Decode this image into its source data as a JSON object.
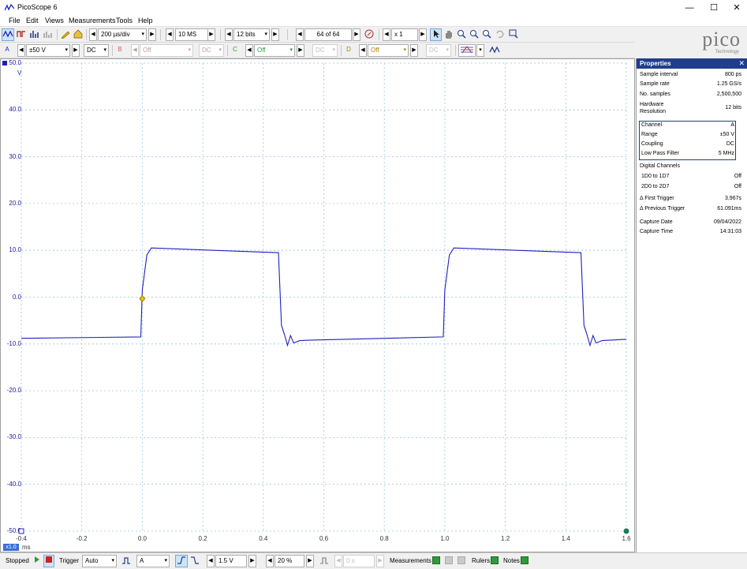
{
  "window": {
    "title": "PicoScope 6",
    "minimize": "—",
    "maximize": "☐",
    "close": "✕"
  },
  "menu": [
    "File",
    "Edit",
    "Views",
    "Measurements",
    "Tools",
    "Help"
  ],
  "toolbar": {
    "timebase": "200 µs/div",
    "samples": "10 MS",
    "resolution": "12 bits",
    "buffer": "64 of 64",
    "zoom": "x 1"
  },
  "channels": [
    {
      "label": "A",
      "range": "±50 V",
      "coupling": "DC",
      "color": "#1f1fbf",
      "enabled": true
    },
    {
      "label": "B",
      "range": "Off",
      "coupling": "DC",
      "color": "#d06060",
      "enabled": false
    },
    {
      "label": "C",
      "range": "Off",
      "coupling": "DC",
      "color": "#2e9b3a",
      "enabled": false
    },
    {
      "label": "D",
      "range": "Off",
      "coupling": "DC",
      "color": "#b08000",
      "enabled": false
    }
  ],
  "logo": {
    "word": "pico",
    "sub": "Technology"
  },
  "plot": {
    "y_unit": "V",
    "y_ticks": [
      "50.0",
      "40.0",
      "30.0",
      "20.0",
      "10.0",
      "0.0",
      "-10.0",
      "-20.0",
      "-30.0",
      "-40.0",
      "-50.0"
    ],
    "x_ticks": [
      "-0.4",
      "-0.2",
      "0.0",
      "0.2",
      "0.4",
      "0.6",
      "0.8",
      "1.0",
      "1.2",
      "1.4",
      "1.6"
    ],
    "x_multiplier": "x1.0",
    "x_unit": "ms",
    "trace_color": "#1f1fbf",
    "trigger_color": "#e0c000"
  },
  "chart_data": {
    "type": "line",
    "x_unit": "ms",
    "y_unit": "V",
    "xlim": [
      -0.4,
      1.6
    ],
    "ylim": [
      -50,
      50
    ],
    "grid": true,
    "series": [
      {
        "x": [
          -0.4,
          -0.005,
          0.0,
          0.015,
          0.03,
          0.45,
          0.46,
          0.47,
          0.48,
          0.49,
          0.5,
          0.52,
          0.55,
          0.995,
          1.0,
          1.015,
          1.03,
          1.45,
          1.46,
          1.47,
          1.48,
          1.49,
          1.5,
          1.52,
          1.6
        ],
        "y": [
          -8.8,
          -8.5,
          1.5,
          9.0,
          10.5,
          9.5,
          -6.0,
          -8.0,
          -10.3,
          -8.2,
          -9.8,
          -9.3,
          -9.2,
          -8.5,
          1.5,
          9.0,
          10.5,
          9.5,
          -6.0,
          -8.0,
          -10.3,
          -8.2,
          -9.8,
          -9.3,
          -9.0
        ]
      }
    ]
  },
  "properties": {
    "title": "Properties",
    "close": "✕",
    "rows": [
      {
        "k": "Sample interval",
        "v": "800 ps"
      },
      {
        "k": "Sample rate",
        "v": "1.25 GS/s"
      },
      {
        "k": "No. samples",
        "v": "2,500,500"
      },
      {
        "k": "Hardware Resolution",
        "v": "12 bits"
      }
    ],
    "channel_rows": [
      {
        "k": "Channel",
        "v": "A"
      },
      {
        "k": "Range",
        "v": "±50 V"
      },
      {
        "k": "Coupling",
        "v": "DC"
      },
      {
        "k": "Low Pass Filter",
        "v": "5 MHz"
      }
    ],
    "digital_title": "Digital Channels",
    "digital_rows": [
      {
        "k": "1D0 to 1D7",
        "v": "Off"
      },
      {
        "k": "2D0 to 2D7",
        "v": "Off"
      }
    ],
    "trigger_rows": [
      {
        "k": "Δ First Trigger",
        "v": "3.967s"
      },
      {
        "k": "Δ Previous Trigger",
        "v": "61.091ms"
      }
    ],
    "capture_rows": [
      {
        "k": "Capture Date",
        "v": "09/04/2022"
      },
      {
        "k": "Capture Time",
        "v": "14:31:03"
      }
    ]
  },
  "status": {
    "state": "Stopped",
    "trigger_label": "Trigger",
    "trigger_mode": "Auto",
    "trigger_source": "A",
    "threshold": "1.5 V",
    "pre_trigger": "20 %",
    "delay": "0 s",
    "measurements": "Measurements",
    "rulers": "Rulers",
    "notes": "Notes"
  }
}
